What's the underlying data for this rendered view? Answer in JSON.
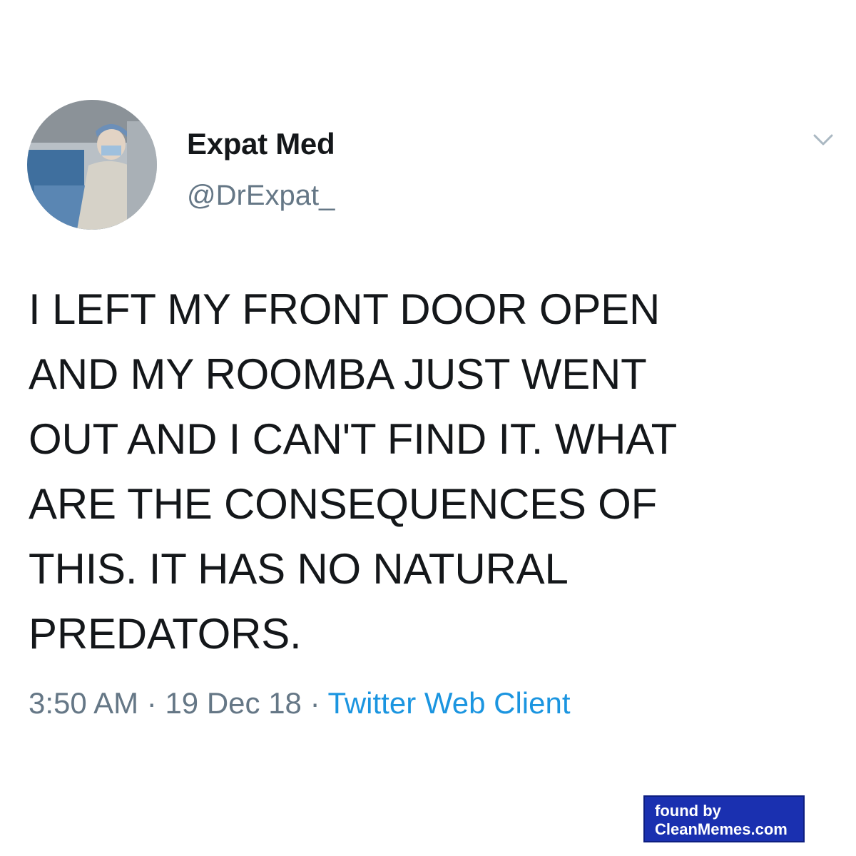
{
  "tweet": {
    "display_name": "Expat Med",
    "handle": "@DrExpat_",
    "avatar_icon": "avatar-photo",
    "menu_icon": "chevron-down-icon",
    "text": "I LEFT MY FRONT DOOR OPEN\nAND MY ROOMBA JUST WENT\nOUT AND I CAN'T FIND IT. WHAT\nARE THE CONSEQUENCES OF\nTHIS. IT HAS NO NATURAL\nPREDATORS.",
    "time": "3:50 AM",
    "separator": "·",
    "date": "19 Dec 18",
    "source": "Twitter Web Client"
  },
  "watermark": {
    "line1": "found by",
    "line2": "CleanMemes.com"
  },
  "colors": {
    "text": "#14171a",
    "secondary": "#657786",
    "link": "#1b95e0",
    "watermark_bg": "#1a30b0"
  }
}
